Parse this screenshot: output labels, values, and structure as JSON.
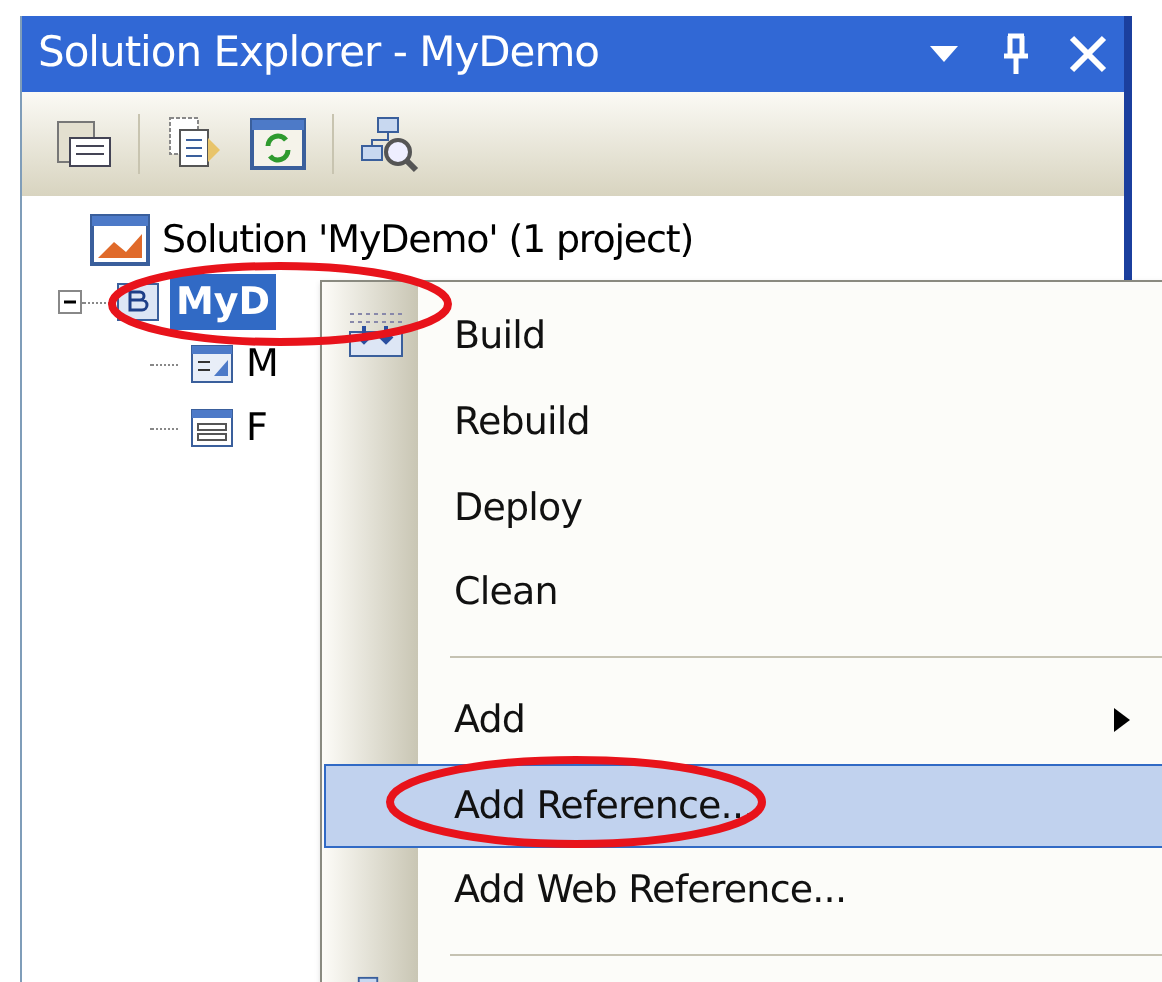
{
  "window": {
    "title": "Solution Explorer - MyDemo"
  },
  "tree": {
    "label": "Solution 'MyDemo' (1 project)",
    "children": [
      {
        "label": "MyD",
        "selected": true,
        "expanded": true,
        "children": [
          {
            "label": "M",
            "kind": "properties"
          },
          {
            "label": "F",
            "kind": "form"
          }
        ]
      }
    ]
  },
  "context_menu": {
    "items": [
      {
        "kind": "item",
        "label": "Build",
        "icon": true,
        "selected": false,
        "submenu": false
      },
      {
        "kind": "item",
        "label": "Rebuild",
        "icon": false,
        "selected": false,
        "submenu": false
      },
      {
        "kind": "item",
        "label": "Deploy",
        "icon": false,
        "selected": false,
        "submenu": false
      },
      {
        "kind": "item",
        "label": "Clean",
        "icon": false,
        "selected": false,
        "submenu": false
      },
      {
        "kind": "separator"
      },
      {
        "kind": "item",
        "label": "Add",
        "icon": false,
        "selected": false,
        "submenu": true
      },
      {
        "kind": "item",
        "label": "Add Reference...",
        "icon": false,
        "selected": true,
        "submenu": false
      },
      {
        "kind": "item",
        "label": "Add Web Reference...",
        "icon": false,
        "selected": false,
        "submenu": false
      },
      {
        "kind": "separator"
      }
    ]
  }
}
